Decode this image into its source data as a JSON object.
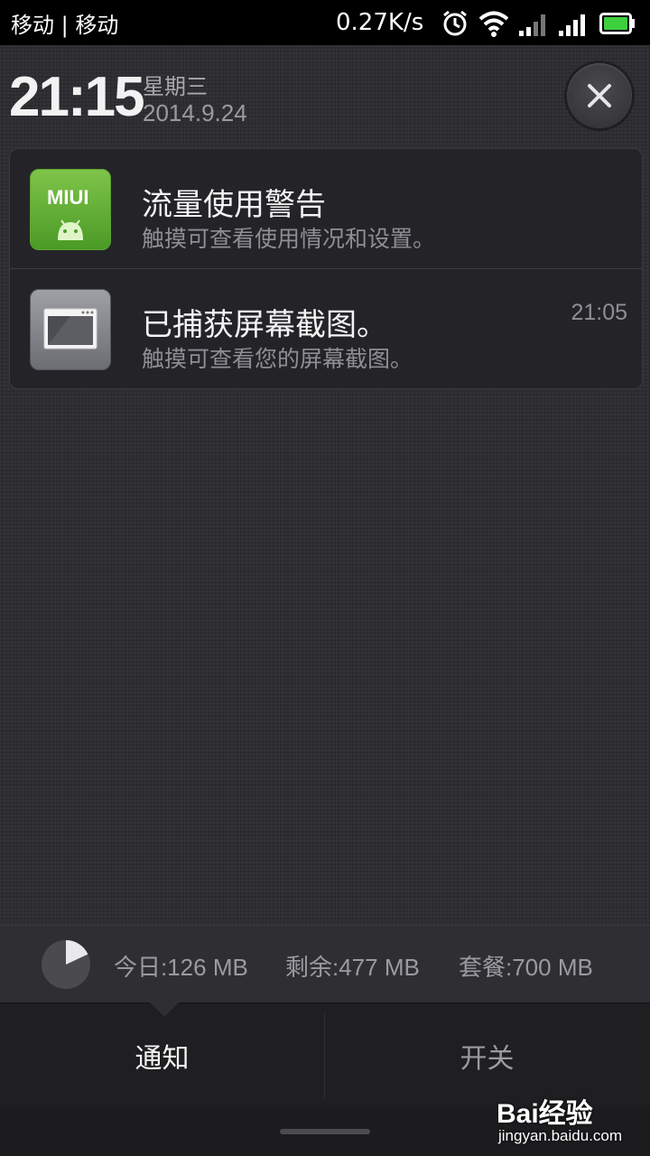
{
  "status_bar": {
    "carrier": "移动 | 移动",
    "net_speed": "0.27K/s",
    "icons": [
      "alarm-icon",
      "wifi-icon",
      "signal-icon",
      "signal-icon",
      "battery-icon"
    ]
  },
  "header": {
    "time": "21:15",
    "weekday": "星期三",
    "date": "2014.9.24",
    "close_icon": "close-icon"
  },
  "notifications": [
    {
      "icon": "miui-android-icon",
      "icon_label": "MIUI",
      "title": "流量使用警告",
      "text": "触摸可查看使用情况和设置。",
      "time": ""
    },
    {
      "icon": "screenshot-icon",
      "title": "已捕获屏幕截图。",
      "text": "触摸可查看您的屏幕截图。",
      "time": "21:05"
    }
  ],
  "data_usage": {
    "today": "今日:126 MB",
    "remaining": "剩余:477 MB",
    "plan": "套餐:700 MB",
    "used_fraction": 0.18
  },
  "tabs": {
    "notifications": "通知",
    "toggles": "开关"
  },
  "watermark": {
    "brand": "Bai经验",
    "url": "jingyan.baidu.com"
  },
  "colors": {
    "background": "#2c2c30",
    "miui_green": "#6bb53a",
    "text_secondary": "#8e8e94"
  }
}
